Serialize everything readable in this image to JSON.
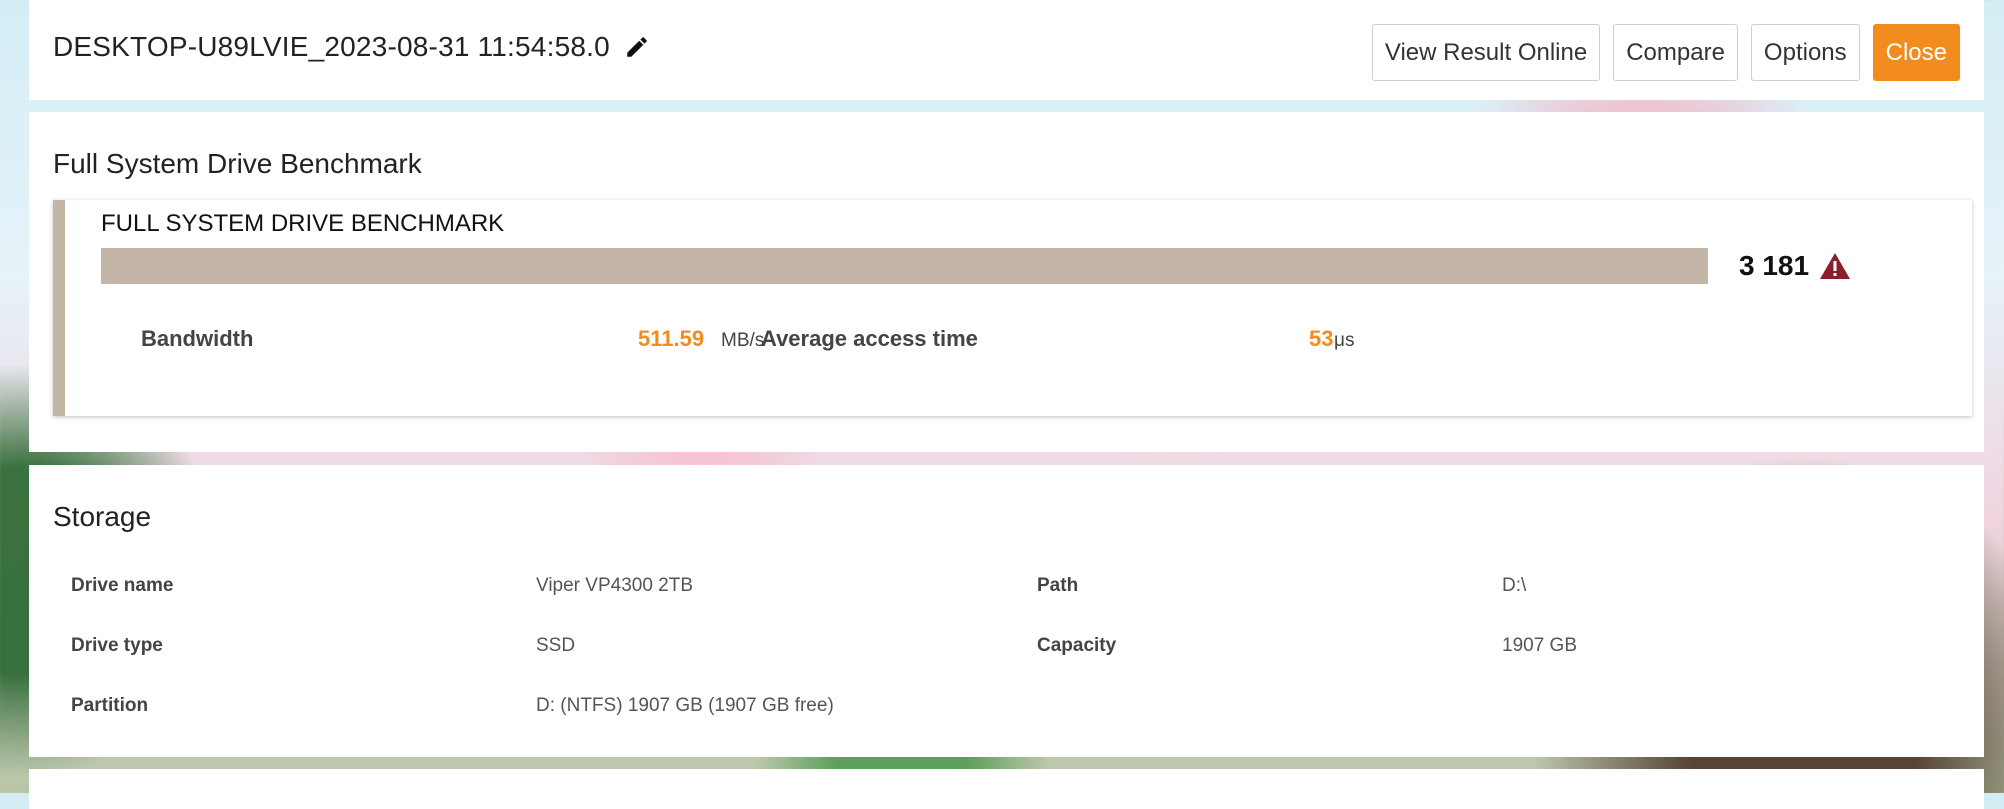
{
  "header": {
    "title": "DESKTOP-U89LVIE_2023-08-31 11:54:58.0",
    "buttons": {
      "view_online": "View Result Online",
      "compare": "Compare",
      "options": "Options",
      "close": "Close"
    }
  },
  "benchmark": {
    "section_title": "Full System Drive Benchmark",
    "panel_title": "FULL SYSTEM DRIVE BENCHMARK",
    "score": "3 181",
    "score_icon": "warning-triangle-icon",
    "metrics": {
      "bandwidth": {
        "label": "Bandwidth",
        "value": "511.59",
        "unit": "MB/s"
      },
      "access_time": {
        "label": "Average access time",
        "value": "53",
        "unit": "μs"
      }
    }
  },
  "storage": {
    "section_title": "Storage",
    "drive_name": {
      "label": "Drive name",
      "value": "Viper VP4300 2TB"
    },
    "path": {
      "label": "Path",
      "value": "D:\\"
    },
    "drive_type": {
      "label": "Drive type",
      "value": "SSD"
    },
    "capacity": {
      "label": "Capacity",
      "value": "1907 GB"
    },
    "partition": {
      "label": "Partition",
      "value": "D: (NTFS) 1907 GB (1907 GB free)"
    }
  },
  "colors": {
    "accent": "#f28c1f",
    "score_bar": "#c4b6a7",
    "warning": "#8b1e2b"
  }
}
